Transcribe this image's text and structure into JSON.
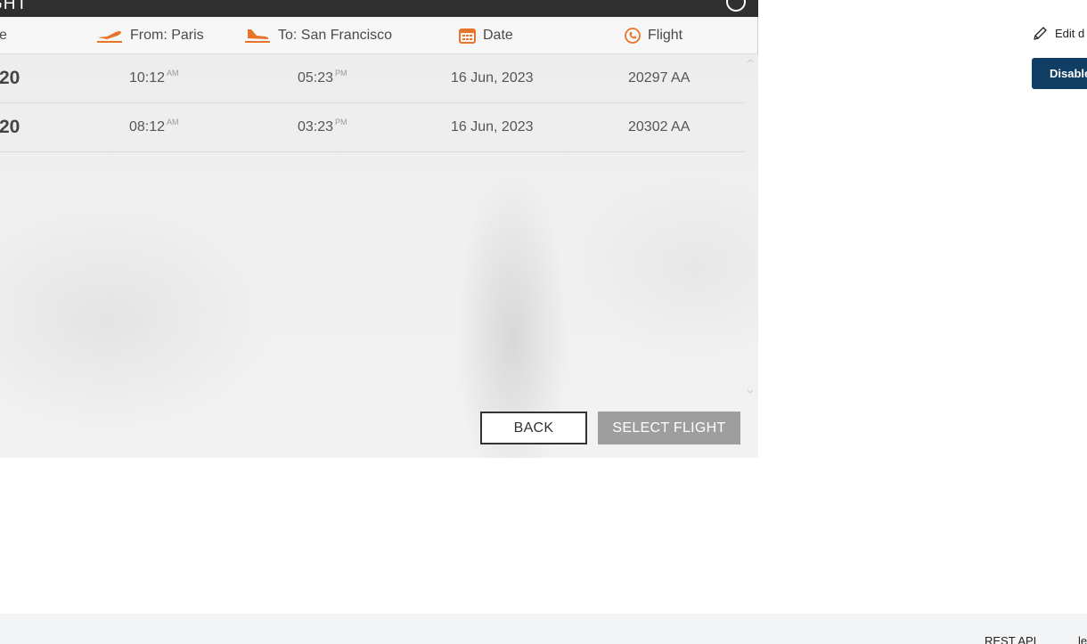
{
  "panel": {
    "title": "GHT",
    "columns": {
      "price": "e",
      "from": "From: Paris",
      "to": "To: San Francisco",
      "date": "Date",
      "flight": "Flight"
    },
    "rows": [
      {
        "price": "20",
        "depart_time": "10:12",
        "depart_ampm": "AM",
        "arrive_time": "05:23",
        "arrive_ampm": "PM",
        "date": "16 Jun, 2023",
        "flight": "20297 AA"
      },
      {
        "price": "20",
        "depart_time": "08:12",
        "depart_ampm": "AM",
        "arrive_time": "03:23",
        "arrive_ampm": "PM",
        "date": "16 Jun, 2023",
        "flight": "20302 AA"
      }
    ],
    "back_label": "BACK",
    "select_label": "SELECT FLIGHT"
  },
  "side": {
    "edit_label": "Edit d",
    "disable_label": "Disable"
  },
  "footer": {
    "links": [
      "REST API",
      "le"
    ]
  },
  "colors": {
    "title_bar": "#2f2f2f",
    "accent_orange": "#e8742a",
    "disable_button": "#0f3d63",
    "select_button": "#9e9e9e"
  },
  "icons": {
    "help": "help-circle-icon",
    "from": "plane-takeoff-icon",
    "to": "plane-landing-icon",
    "date": "calendar-icon",
    "flight": "phone-icon",
    "edit": "pencil-icon"
  }
}
